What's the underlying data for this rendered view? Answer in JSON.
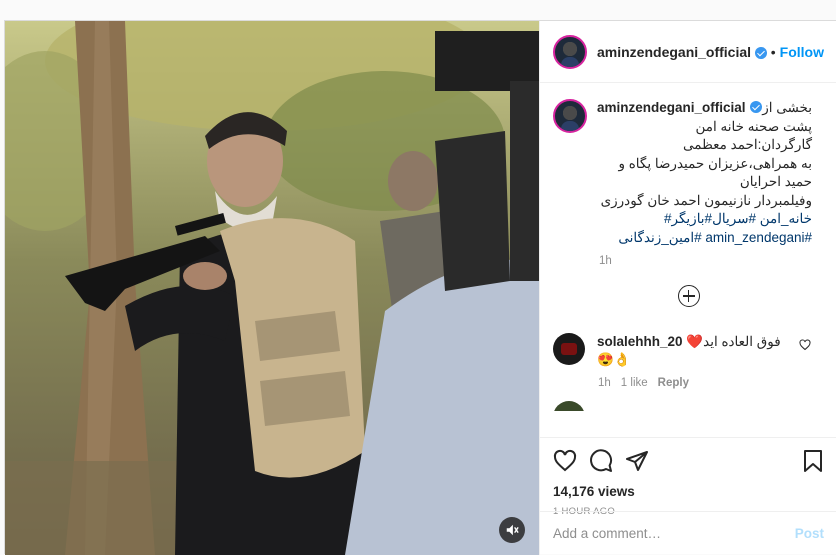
{
  "post": {
    "username": "aminzendegani_official",
    "follow_label": "Follow",
    "dot": "•",
    "caption_lines": [
      "بخشی از",
      "پشت صحنه خانه امن",
      "گارگردان:احمد معظمی",
      "به همراهی،عزیزان حمیدرضا پگاه و",
      "حمید احرایان",
      "وفیلمبردار نازنیمون احمد خان گودرزی"
    ],
    "hashtags_line1": "خانه_امن #سریال#بازیگر#",
    "hashtags_line2": "#amin_zendegani #امین_زندگانی",
    "caption_time": "1h",
    "views": "14,176 views",
    "posted_ago": "1 HOUR AGO"
  },
  "comments": [
    {
      "username": "solalehhh_20",
      "text": "فوق العاده اید",
      "emoji_after": "❤️",
      "emoji_line": "😍👌",
      "time": "1h",
      "likes": "1 like",
      "reply_label": "Reply"
    }
  ],
  "comment_box": {
    "placeholder": "Add a comment…",
    "post_label": "Post"
  },
  "icons": {
    "verified": "verified-badge-icon",
    "load_more": "plus-circle-icon",
    "like": "heart-icon",
    "comment": "comment-icon",
    "share": "paper-plane-icon",
    "save": "bookmark-icon",
    "mute": "speaker-muted-icon"
  },
  "colors": {
    "accent": "#0095f6",
    "hashtag": "#00376b",
    "muted_text": "#8e8e8e",
    "post_disabled": "#b2dffc",
    "heart_red": "#ed4956"
  }
}
